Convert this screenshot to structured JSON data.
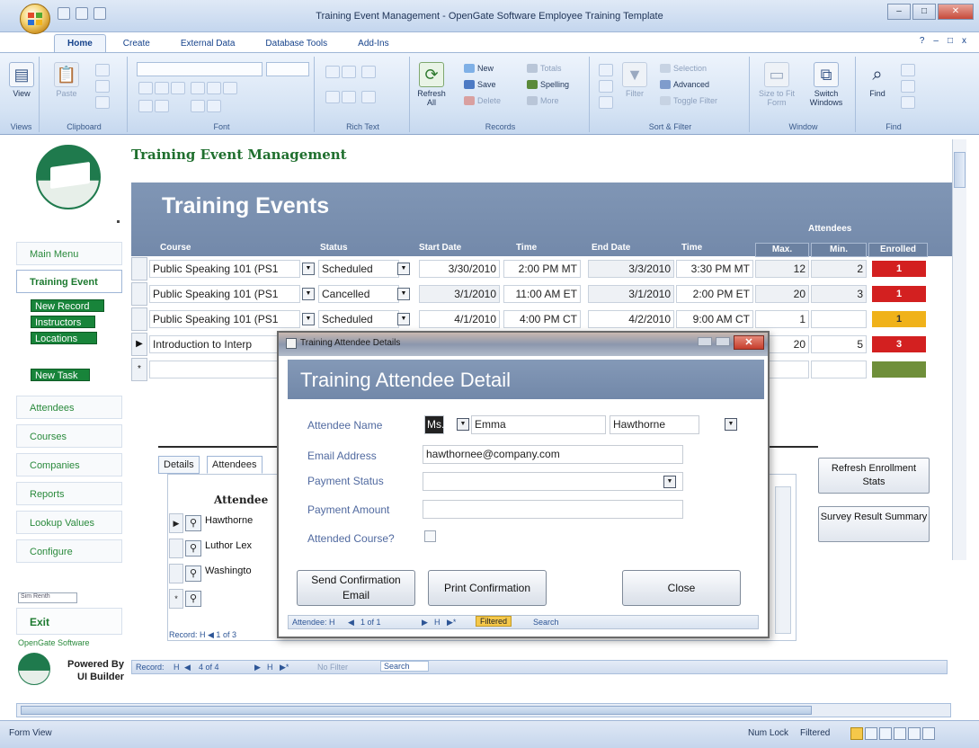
{
  "window": {
    "title": "Training Event Management - OpenGate Software Employee Training Template",
    "controls": [
      "–",
      "□",
      "✕"
    ]
  },
  "ribbon": {
    "tabs": [
      "Home",
      "Create",
      "External Data",
      "Database Tools",
      "Add-Ins"
    ],
    "right_controls": [
      "?",
      "–",
      "□",
      "x"
    ],
    "groups": {
      "views": "Views",
      "clipboard": "Clipboard",
      "font": "Font",
      "rich_text": "Rich Text",
      "records": "Records",
      "sort_filter": "Sort & Filter",
      "window": "Window",
      "find": "Find"
    },
    "buttons": {
      "view": "View",
      "paste": "Paste",
      "refresh": "Refresh All",
      "new": "New",
      "save": "Save",
      "delete": "Delete",
      "totals": "Totals",
      "spelling": "Spelling",
      "more": "More",
      "filter": "Filter",
      "selection": "Selection",
      "advanced": "Advanced",
      "toggle_filter": "Toggle Filter",
      "size_to_fit": "Size to Fit Form",
      "switch_windows": "Switch Windows",
      "find": "Find"
    }
  },
  "nav": {
    "items": {
      "main_menu": "Main Menu",
      "training_events": "Training Event",
      "attendees": "Attendees",
      "courses": "Courses",
      "companies": "Companies",
      "reports": "Reports",
      "lookup_values": "Lookup Values",
      "configure": "Configure"
    },
    "sub_buttons": {
      "new_record": "New Record",
      "instructors": "Instructors",
      "locations": "Locations",
      "new_task": "New Task"
    },
    "small_input": "Sim Renth",
    "exit": "Exit",
    "opengate": "OpenGate Software",
    "powered_by_1": "Powered By",
    "powered_by_2": "UI Builder"
  },
  "form": {
    "title": "Training Event Management",
    "banner": "Training Events",
    "attendees_header": "Attendees",
    "columns": {
      "course": "Course",
      "status": "Status",
      "start_date": "Start Date",
      "start_time": "Time",
      "end_date": "End Date",
      "end_time": "Time",
      "max": "Max.",
      "min": "Min.",
      "enrolled": "Enrolled"
    },
    "rows": [
      {
        "course": "Public Speaking 101 (PS1",
        "status": "Scheduled",
        "start_date": "3/30/2010",
        "start_time": "2:00 PM MT",
        "end_date": "3/3/2010",
        "end_time": "3:30 PM MT",
        "max": "12",
        "min": "2",
        "enrolled": "1",
        "enrolled_color": "#d32020"
      },
      {
        "course": "Public Speaking 101 (PS1",
        "status": "Cancelled",
        "start_date": "3/1/2010",
        "start_time": "11:00 AM ET",
        "end_date": "3/1/2010",
        "end_time": "2:00 PM ET",
        "max": "20",
        "min": "3",
        "enrolled": "1",
        "enrolled_color": "#d32020"
      },
      {
        "course": "Public Speaking 101 (PS1",
        "status": "Scheduled",
        "start_date": "4/1/2010",
        "start_time": "4:00 PM CT",
        "end_date": "4/2/2010",
        "end_time": "9:00 AM CT",
        "max": "1",
        "min": "",
        "enrolled": "1",
        "enrolled_color": "#f0b21a"
      },
      {
        "course": "Introduction to Interp",
        "status": "",
        "start_date": "",
        "start_time": "",
        "end_date": "",
        "end_time": "",
        "max": "20",
        "min": "5",
        "enrolled": "3",
        "enrolled_color": "#d32020"
      }
    ],
    "new_row_enrolled_color": "#6f8f3a"
  },
  "subform": {
    "tabs": [
      "Details",
      "Attendees"
    ],
    "header": "Attendee",
    "attendees": [
      "Hawthorne",
      "Luthor Lex",
      "Washingto"
    ],
    "record_nav": "Record: H  ◀ 1 of 3"
  },
  "side_buttons": {
    "refresh_stats": "Refresh Enrollment Stats",
    "survey_summary": "Survey Result Summary"
  },
  "record_nav": {
    "label": "Record:",
    "nav_first": "H",
    "nav_prev": "◀",
    "position": "4 of 4",
    "nav_next": "▶",
    "nav_last": "H",
    "nav_new": "▶*",
    "filter": "No Filter",
    "search": "Search"
  },
  "dialog": {
    "title": "Training Attendee Details",
    "banner": "Training Attendee Detail",
    "labels": {
      "name": "Attendee Name",
      "email": "Email Address",
      "payment_status": "Payment Status",
      "payment_amount": "Payment Amount",
      "attended": "Attended Course?"
    },
    "values": {
      "salutation": "Ms.",
      "first_name": "Emma",
      "last_name": "Hawthorne",
      "email": "hawthornee@company.com",
      "payment_status": "",
      "payment_amount": ""
    },
    "buttons": {
      "send_confirmation_1": "Send Confirmation",
      "send_confirmation_2": "Email",
      "print_confirmation": "Print Confirmation",
      "close": "Close"
    },
    "record_nav": {
      "label": "Attendee: H",
      "prev": "◀",
      "position": "1 of 1",
      "next": "▶",
      "last": "H",
      "new": "▶*",
      "filtered": "Filtered",
      "search": "Search"
    }
  },
  "statusbar": {
    "left": "Form View",
    "num_lock": "Num Lock",
    "filtered": "Filtered"
  }
}
